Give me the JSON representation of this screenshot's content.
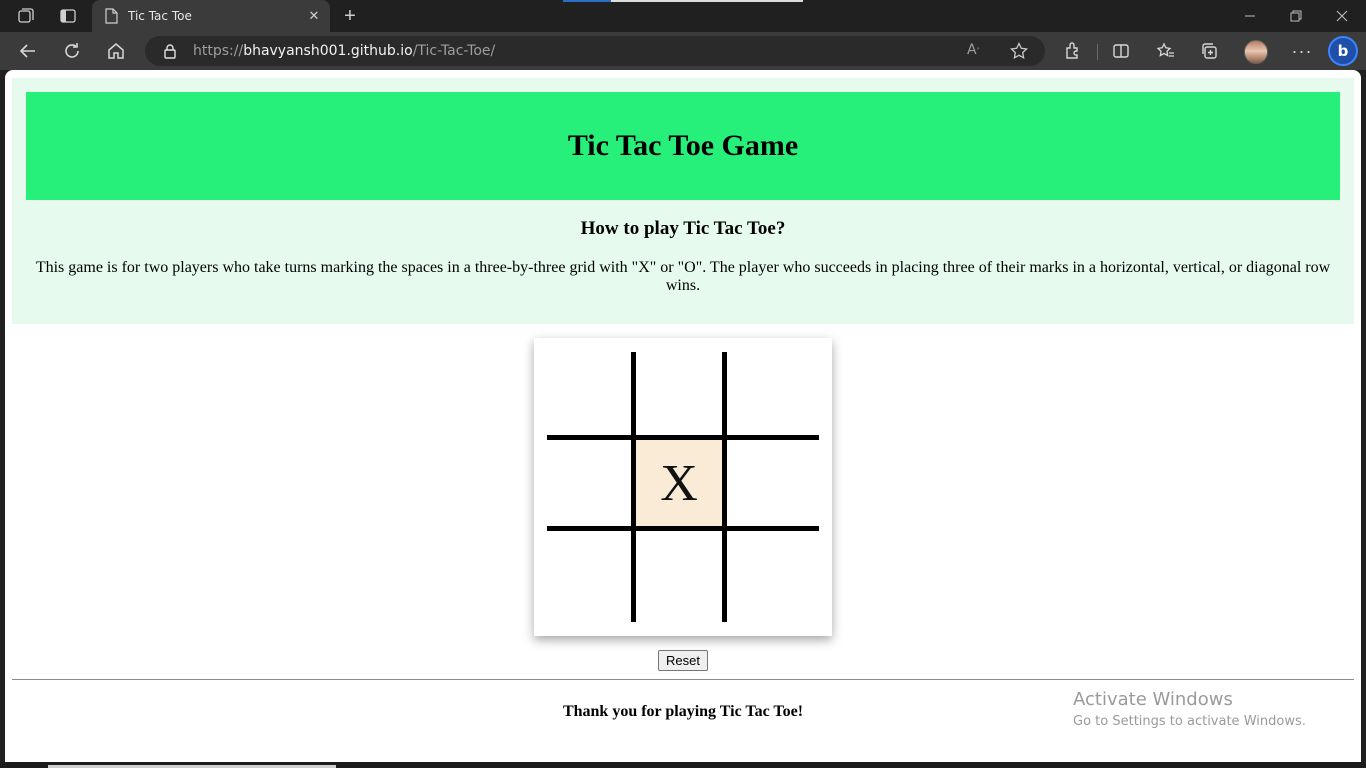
{
  "browser": {
    "tab_title": "Tic Tac Toe",
    "url_scheme": "https://",
    "url_host": "bhavyansh001.github.io",
    "url_path": "/Tic-Tac-Toe/",
    "profile_avatar": "avatar",
    "copilot_label": "b"
  },
  "page": {
    "banner_title": "Tic Tac Toe Game",
    "how_to_heading": "How to play Tic Tac Toe?",
    "description": "This game is for two players who take turns marking the spaces in a three-by-three grid with \"X\" or \"O\". The player who succeeds in placing three of their marks in a horizontal, vertical, or diagonal row wins.",
    "board": [
      "",
      "",
      "",
      "",
      "X",
      "",
      "",
      "",
      ""
    ],
    "highlighted_cell": 4,
    "reset_label": "Reset",
    "footer_text": "Thank you for playing Tic Tac Toe!"
  },
  "os_watermark": {
    "line1": "Activate Windows",
    "line2": "Go to Settings to activate Windows."
  },
  "colors": {
    "banner": "#26f07a",
    "info_bg": "#e6fbee",
    "cell_highlight": "#faebd7"
  }
}
